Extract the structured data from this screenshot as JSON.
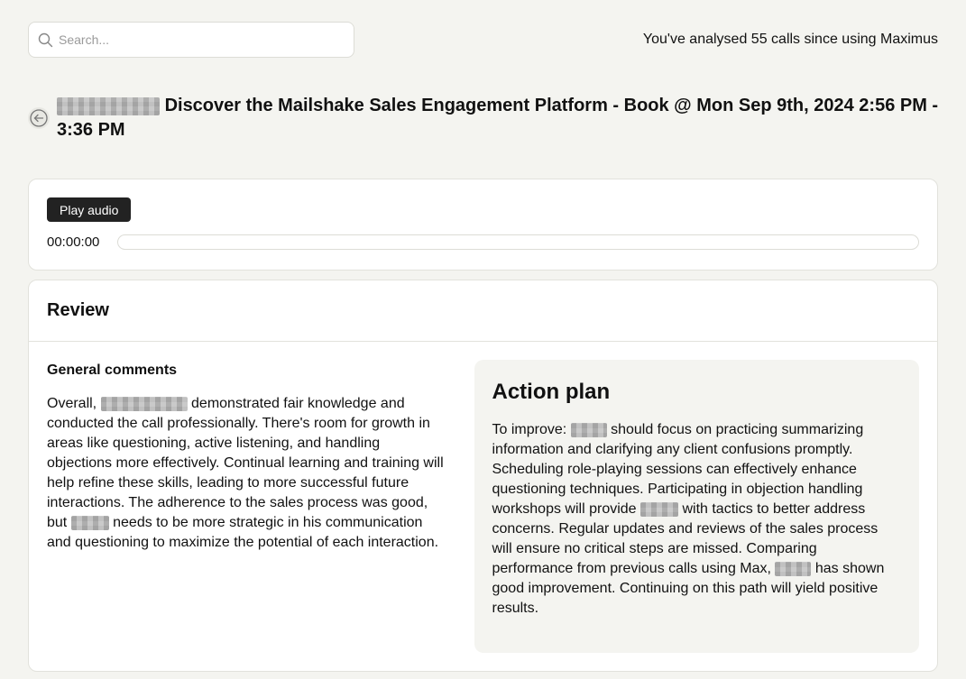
{
  "search": {
    "placeholder": "Search..."
  },
  "stats": {
    "text": "You've analysed 55 calls since using Maximus"
  },
  "call": {
    "title": "Discover the Mailshake Sales Engagement Platform - Book @ Mon Sep 9th, 2024 2:56 PM - 3:36 PM"
  },
  "audio": {
    "play_label": "Play audio",
    "time": "00:00:00",
    "progress": 0
  },
  "review": {
    "heading": "Review",
    "general": {
      "heading": "General comments",
      "p1": "Overall, ",
      "p2": " demonstrated fair knowledge and conducted the call professionally. There's room for growth in areas like questioning, active listening, and handling objections more effectively. Continual learning and training will help refine these skills, leading to more successful future interactions. The adherence to the sales process was good, but ",
      "p3": " needs to be more strategic in his communication and questioning to maximize the potential of each interaction."
    },
    "action_plan": {
      "heading": "Action plan",
      "p1": "To improve: ",
      "p2": " should focus on practicing summarizing information and clarifying any client confusions promptly. Scheduling role-playing sessions can effectively enhance questioning techniques. Participating in objection handling workshops will provide ",
      "p3": " with tactics to better address concerns. Regular updates and reviews of the sales process will ensure no critical steps are missed. Comparing performance from previous calls using Max, ",
      "p4": " has shown good improvement. Continuing on this path will yield positive results."
    }
  }
}
